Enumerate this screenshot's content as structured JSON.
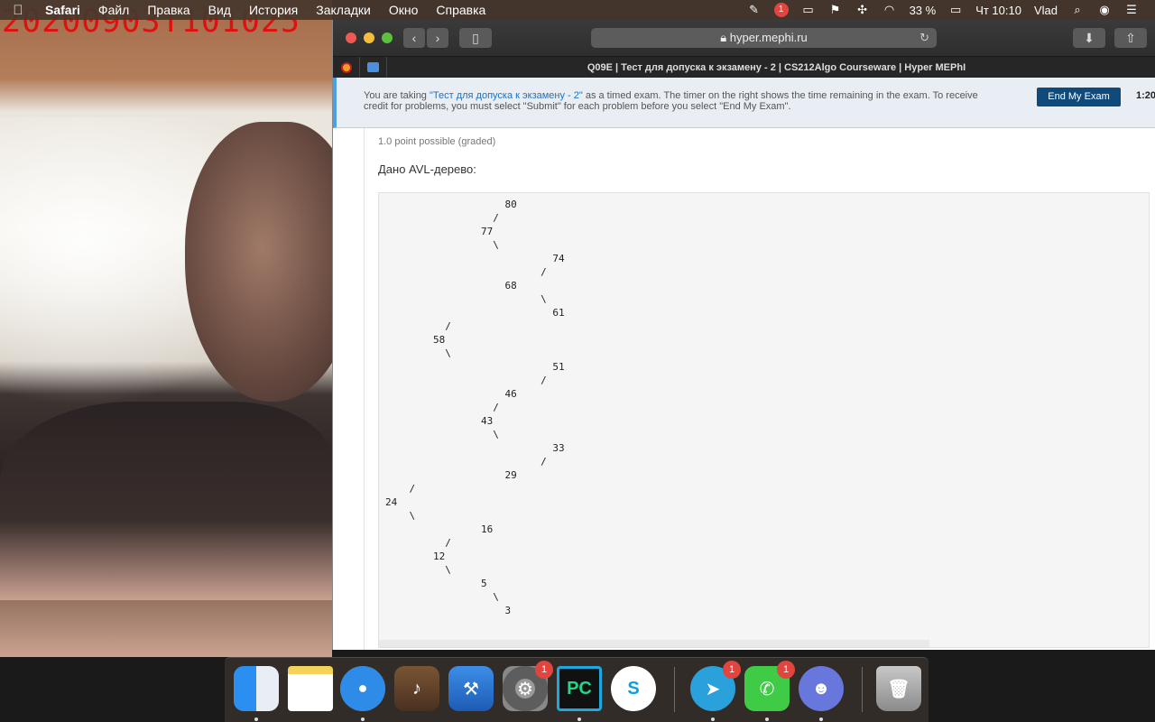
{
  "menubar": {
    "items": [
      "Safari",
      "Файл",
      "Правка",
      "Вид",
      "История",
      "Закладки",
      "Окно",
      "Справка"
    ],
    "battery": "33 %",
    "clock": "Чт 10:10",
    "user": "Vlad",
    "notification_count": "1"
  },
  "webcam": {
    "timestamp": "20200903T101025"
  },
  "browser": {
    "url": "hyper.mephi.ru",
    "tab_title": "Q09E | Тест для допуска к экзамену - 2 | CS212Algo Courseware | Hyper MEPhI"
  },
  "banner": {
    "msg_before": "You are taking ",
    "exam_link": "\"Тест для допуска к экзамену - 2\"",
    "msg_after": " as a timed exam. The timer on the right shows the time remaining in the exam. To receive credit for problems, you must select \"Submit\" for each problem before you select \"End My Exam\".",
    "end_button": "End My Exam",
    "timer": "1:20:"
  },
  "problem": {
    "points": "1.0 point possible (graded)",
    "prompt": "Дано AVL-дерево:",
    "tree_text": "                    80\n                  /\n                77\n                  \\\n                            74\n                          /\n                    68\n                          \\\n                            61\n          /\n        58\n          \\\n                            51\n                          /\n                    46\n                  /\n                43\n                  \\\n                            33\n                          /\n                    29\n    /\n24\n    \\\n                16\n          /\n        12\n          \\\n                5\n                  \\\n                    3"
  },
  "dock": {
    "badges": {
      "settings": "1",
      "telegram": "1",
      "facetime": "1"
    },
    "pycharm_label": "PC"
  }
}
